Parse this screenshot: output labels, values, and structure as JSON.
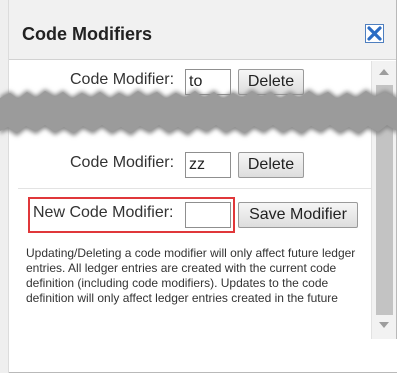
{
  "dialog": {
    "title": "Code Modifiers",
    "close_icon": "close-x-icon"
  },
  "modifiers": [
    {
      "label": "Code Modifier:",
      "value": "to",
      "delete_label": "Delete"
    },
    {
      "label": "Code Modifier:",
      "value": "zz",
      "delete_label": "Delete"
    }
  ],
  "new_modifier": {
    "label": "New Code Modifier:",
    "value": "",
    "save_label": "Save Modifier"
  },
  "info_text": "Updating/Deleting a code modifier will only affect future ledger entries. All ledger entries are created with the current code definition (including code modifiers). Updates to the code definition will only affect ledger entries created in the future",
  "colors": {
    "highlight": "#e0373a",
    "close_icon": "#2b6cc4"
  }
}
